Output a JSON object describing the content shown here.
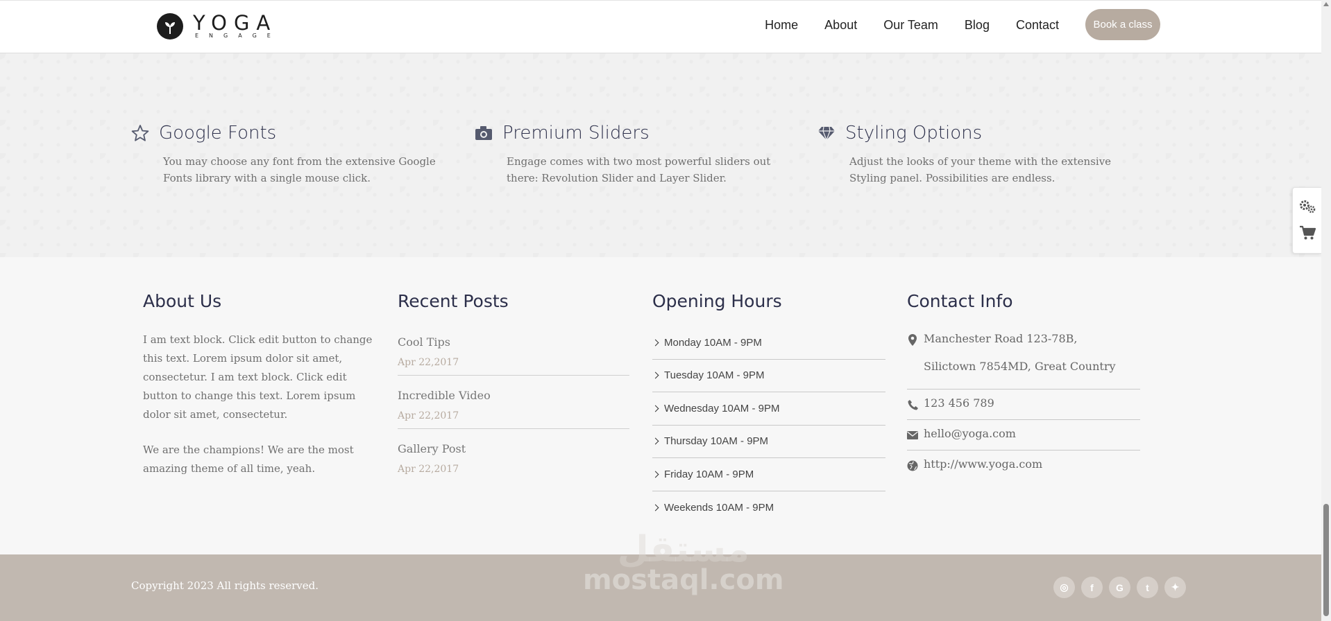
{
  "header": {
    "logo": {
      "word": "YOGA",
      "sub": "ENGAGE"
    },
    "nav": [
      "Home",
      "About",
      "Our Team",
      "Blog",
      "Contact"
    ],
    "cta": "Book a class"
  },
  "features": [
    {
      "icon": "star-icon",
      "title": "Google Fonts",
      "desc": "You may choose any font from the extensive Google Fonts library with a single mouse click."
    },
    {
      "icon": "camera-icon",
      "title": "Premium Sliders",
      "desc": "Engage comes with two most powerful sliders out there: Revolution Slider and Layer Slider."
    },
    {
      "icon": "diamond-icon",
      "title": "Styling Options",
      "desc": "Adjust the looks of your theme with the extensive Styling panel. Possibilities are endless."
    }
  ],
  "footer": {
    "about": {
      "title": "About Us",
      "p1": "I am text block. Click edit button to change this text. Lorem ipsum dolor sit amet, consectetur. I am text block. Click edit button to change this text. Lorem ipsum dolor sit amet, consectetur.",
      "p2": "We are the champions! We are the most amazing theme of all time, yeah."
    },
    "recent": {
      "title": "Recent Posts",
      "posts": [
        {
          "title": "Cool Tips",
          "date": "Apr 22,2017"
        },
        {
          "title": "Incredible Video",
          "date": "Apr 22,2017"
        },
        {
          "title": "Gallery Post",
          "date": "Apr 22,2017"
        }
      ]
    },
    "hours": {
      "title": "Opening Hours",
      "rows": [
        "Monday 10AM - 9PM",
        "Tuesday 10AM - 9PM",
        "Wednesday 10AM - 9PM",
        "Thursday 10AM - 9PM",
        "Friday 10AM - 9PM",
        "Weekends 10AM - 9PM"
      ]
    },
    "contact": {
      "title": "Contact Info",
      "address1": "Manchester Road 123-78B,",
      "address2": "Silictown 7854MD, Great Country",
      "phone": "123 456 789",
      "email": "hello@yoga.com",
      "web": "http://www.yoga.com"
    }
  },
  "bottom": {
    "copyright": "Copyright 2023 All rights reserved.",
    "social": [
      {
        "icon": "dribbble-icon",
        "glyph": "◎"
      },
      {
        "icon": "facebook-icon",
        "glyph": "f"
      },
      {
        "icon": "google-icon",
        "glyph": "G"
      },
      {
        "icon": "tumblr-icon",
        "glyph": "t"
      },
      {
        "icon": "twitter-icon",
        "glyph": "✦"
      }
    ]
  },
  "watermark": {
    "top": "مستقل",
    "bottom": "mostaql.com"
  },
  "colors": {
    "accent": "#b7aba0",
    "heading": "#2c2f4a",
    "footer_bar": "#c1b8b0"
  }
}
